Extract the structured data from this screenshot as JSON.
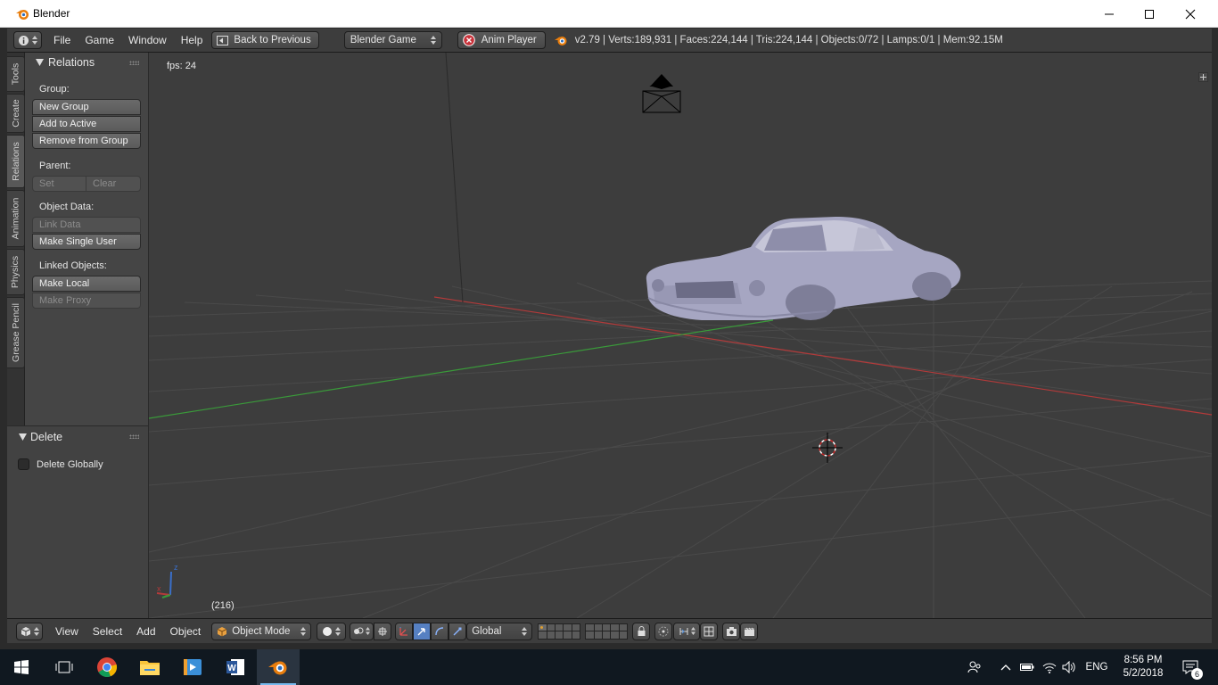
{
  "window": {
    "title": "Blender",
    "controls": [
      "minimize-icon",
      "maximize-icon",
      "close-icon"
    ]
  },
  "topbar": {
    "menus": [
      "File",
      "Game",
      "Window",
      "Help"
    ],
    "back_button": "Back to Previous",
    "engine": "Blender Game",
    "anim_player": "Anim Player",
    "stats": "v2.79 | Verts:189,931 | Faces:224,144 | Tris:224,144 | Objects:0/72 | Lamps:0/1 | Mem:92.15M"
  },
  "tabs": [
    "Tools",
    "Create",
    "Relations",
    "Animation",
    "Physics",
    "Grease Pencil"
  ],
  "active_tab": "Relations",
  "relations": {
    "title": "Relations",
    "group_label": "Group:",
    "new_group": "New Group",
    "add_to_active": "Add to Active",
    "remove_from_group": "Remove from Group",
    "parent_label": "Parent:",
    "set": "Set",
    "clear": "Clear",
    "object_data_label": "Object Data:",
    "link_data": "Link Data",
    "make_single_user": "Make Single User",
    "linked_objects_label": "Linked Objects:",
    "make_local": "Make Local",
    "make_proxy": "Make Proxy"
  },
  "operator": {
    "title": "Delete",
    "delete_globally": "Delete Globally"
  },
  "viewport": {
    "fps": "fps: 24",
    "frame": "(216)",
    "axis_x": "x",
    "axis_z": "z"
  },
  "bottombar": {
    "menus": [
      "View",
      "Select",
      "Add",
      "Object"
    ],
    "mode": "Object Mode",
    "orientation": "Global"
  },
  "taskbar": {
    "language": "ENG",
    "time": "8:56 PM",
    "date": "5/2/2018",
    "notifications": "6"
  },
  "colors": {
    "x_axis": "#b33a3a",
    "y_axis": "#3a9a3a",
    "z_axis": "#3a6fc9",
    "accent": "#5680c2",
    "blender_orange": "#e87d0d"
  }
}
